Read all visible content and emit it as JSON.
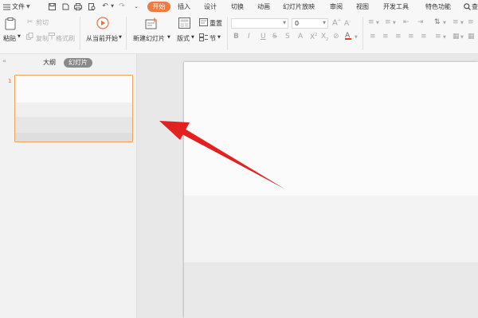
{
  "menubar": {
    "file_label": "文件",
    "tabs": [
      {
        "label": "开始",
        "active": true
      },
      {
        "label": "插入"
      },
      {
        "label": "设计"
      },
      {
        "label": "切换"
      },
      {
        "label": "动画"
      },
      {
        "label": "幻灯片放映"
      },
      {
        "label": "审阅"
      },
      {
        "label": "视图"
      },
      {
        "label": "开发工具"
      },
      {
        "label": "特色功能"
      }
    ],
    "search_label": "查"
  },
  "toolbar": {
    "paste": "粘贴",
    "cut": "剪切",
    "copy": "复制",
    "format_painter": "格式刷",
    "play_from_current": "从当前开始",
    "new_slide": "新建幻灯片",
    "layout": "版式",
    "reset": "重置",
    "section": "节",
    "font_size_value": "0",
    "font_name_value": ""
  },
  "left_panel": {
    "tabs": [
      {
        "label": "大纲"
      },
      {
        "label": "幻灯片",
        "active": true
      }
    ],
    "slide_number": "1"
  },
  "colors": {
    "accent": "#f07b3e",
    "arrow": "#e52020",
    "thumb_border": "#f0a25a"
  }
}
